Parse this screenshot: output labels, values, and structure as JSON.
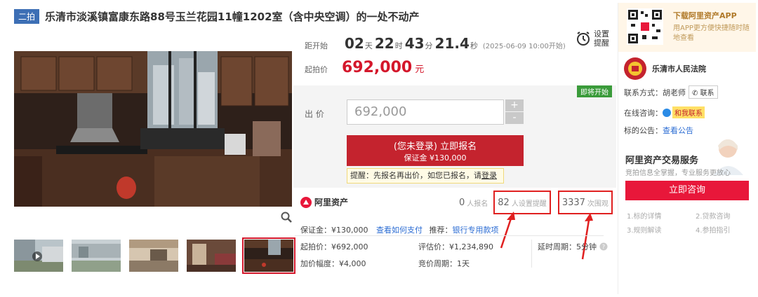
{
  "title": {
    "badge": "二拍",
    "text": "乐清市淡溪镇富康东路88号玉兰花园11幢1202室（含中央空调）的一处不动产"
  },
  "countdown": {
    "label": "距开始",
    "days": "02",
    "days_unit": "天",
    "hours": "22",
    "hours_unit": "时",
    "minutes": "43",
    "minutes_unit": "分",
    "seconds": "21.4",
    "seconds_unit": "秒",
    "start": "(2025-06-09 10:00开始)"
  },
  "remind": {
    "label": "设置提醒",
    "icon": "alarm-clock-icon"
  },
  "start_price": {
    "label": "起拍价",
    "value": "692,000",
    "unit": "元"
  },
  "bid": {
    "status_badge": "即将开始",
    "label": "出 价",
    "value": "692,000",
    "plus": "+",
    "minus": "-",
    "apply_main": "(您未登录) 立即报名",
    "apply_sub": "保证金 ¥130,000",
    "tip_prefix": "提醒：先报名再出价，如您已报名，请",
    "tip_link": "登录"
  },
  "platform": {
    "name": "阿里资产"
  },
  "stats": {
    "signups": "0",
    "signups_label": "人报名",
    "reminders": "82",
    "reminders_label": "人设置提醒",
    "views": "3337",
    "views_label": "次围观"
  },
  "details": {
    "deposit_label": "保证金：",
    "deposit_value": "¥130,000",
    "how_to_pay": "查看如何支付",
    "recommend_label": "推荐：",
    "recommend_link": "银行专用款项",
    "start_price_label": "起拍价：",
    "start_price_value": "¥692,000",
    "eval_label": "评估价：",
    "eval_value": "¥1,234,890",
    "delay_label": "延时周期：",
    "delay_value": "5分钟",
    "increment_label": "加价幅度：",
    "increment_value": "¥4,000",
    "cycle_label": "竞价周期：",
    "cycle_value": "1天"
  },
  "sidebar": {
    "app_title": "下载阿里资产APP",
    "app_desc": "用APP更方便快捷随时随地查看",
    "court": "乐清市人民法院",
    "contact_label": "联系方式：",
    "contact_person": "胡老师",
    "contact_button": "联系",
    "online_label": "在线咨询：",
    "online_button": "和我联系",
    "notice_label": "标的公告：",
    "notice_link": "查看公告",
    "service_title": "阿里资产交易服务",
    "service_desc": "竞拍信息全掌握，专业服务更放心",
    "consult_button": "立即咨询",
    "guides": [
      "1.标的详情",
      "2.贷款咨询",
      "3.规则解读",
      "4.参拍指引"
    ]
  },
  "colors": {
    "accent_red": "#d4172b",
    "brand_blue": "#3d6fb5",
    "button_red": "#c4232e"
  }
}
